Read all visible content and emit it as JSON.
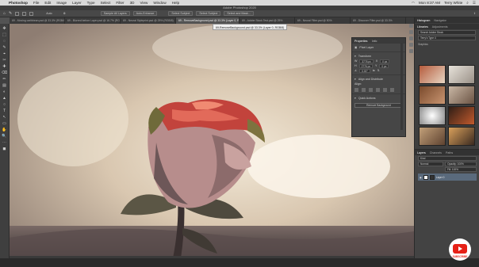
{
  "menubar": {
    "apple": "",
    "items": [
      "Photoshop",
      "File",
      "Edit",
      "Image",
      "Layer",
      "Type",
      "Select",
      "Filter",
      "3D",
      "View",
      "Window",
      "Help"
    ],
    "clock": "Mon 8:37 AM",
    "user": "Terry White"
  },
  "window": {
    "title": "Adobe Photoshop 2020"
  },
  "options": {
    "sample_label": "Auto",
    "btn1": "Sample All Layers",
    "btn2": "Auto-Enhance",
    "btn3": "Select Subject",
    "btn4": "Select Subject",
    "btn5": "Select and Mask..."
  },
  "tabs": [
    {
      "label": "69 - Moving caribbean.psd @ 33.3% (RGB/8)",
      "active": false
    },
    {
      "label": "69 - Blurred before Layer.psd @ 16.7% (RGB/8)",
      "active": false
    },
    {
      "label": "69 - Neural Styleprint.psd @ 25% (RGB/8)",
      "active": false
    },
    {
      "label": "69 - RemoveBackground.psd @ 33.3% (Layer 0, RGB/8)",
      "active": true
    },
    {
      "label": "69 - Adobe Stock Test.psd @ 25%",
      "active": false
    },
    {
      "label": "69 - Neural Filter.psd @ 50%",
      "active": false
    },
    {
      "label": "69 - Discover Filter.psd @ 33.3%",
      "active": false
    }
  ],
  "tooltip": "69-RemoveBackground.psd @ 33.3% (Layer 0, RGB/8)",
  "tools": [
    "✥",
    "⬚",
    "◌",
    "✎",
    "⌖",
    "✂",
    "✚",
    "⌫",
    "✏",
    "▤",
    "◐",
    "▲",
    "○",
    "T",
    "↖",
    "▭",
    "✋",
    "🔍",
    "⋯",
    "◼"
  ],
  "properties": {
    "tab1": "Properties",
    "tab2": "Info",
    "layer_type": "Pixel Layer",
    "transform_title": "Transform",
    "w_label": "W",
    "w_value": "3776 px",
    "x_label": "X",
    "x_value": "0 px",
    "h_label": "H",
    "h_value": "2776 px",
    "y_value": "0 px",
    "angle_value": "0.00°",
    "align_title": "Align and Distribute",
    "align_label": "Align:",
    "quick_title": "Quick Actions",
    "remove_bg": "Remove Background"
  },
  "right": {
    "tab_histogram": "Histogram",
    "tab_navigator": "Navigator",
    "tab_libraries": "Libraries",
    "tab_adjustments": "Adjustments",
    "search_placeholder": "Search Adobe Stock",
    "library_name": "Terry's Type 4",
    "section": "Graphics",
    "layers_tab": "Layers",
    "channels_tab": "Channels",
    "paths_tab": "Paths",
    "kind": "Kind",
    "mode": "Normal",
    "opacity": "Opacity: 100%",
    "fill": "Fill: 100%",
    "layer_name": "Layer 0"
  },
  "youtube": {
    "label": "SUBSCRIBE"
  },
  "colors": {
    "menubar": "#d9d9d9",
    "canvas_bg": "#474747",
    "accent": "#5a6a7c",
    "youtube_red": "#e62117"
  }
}
